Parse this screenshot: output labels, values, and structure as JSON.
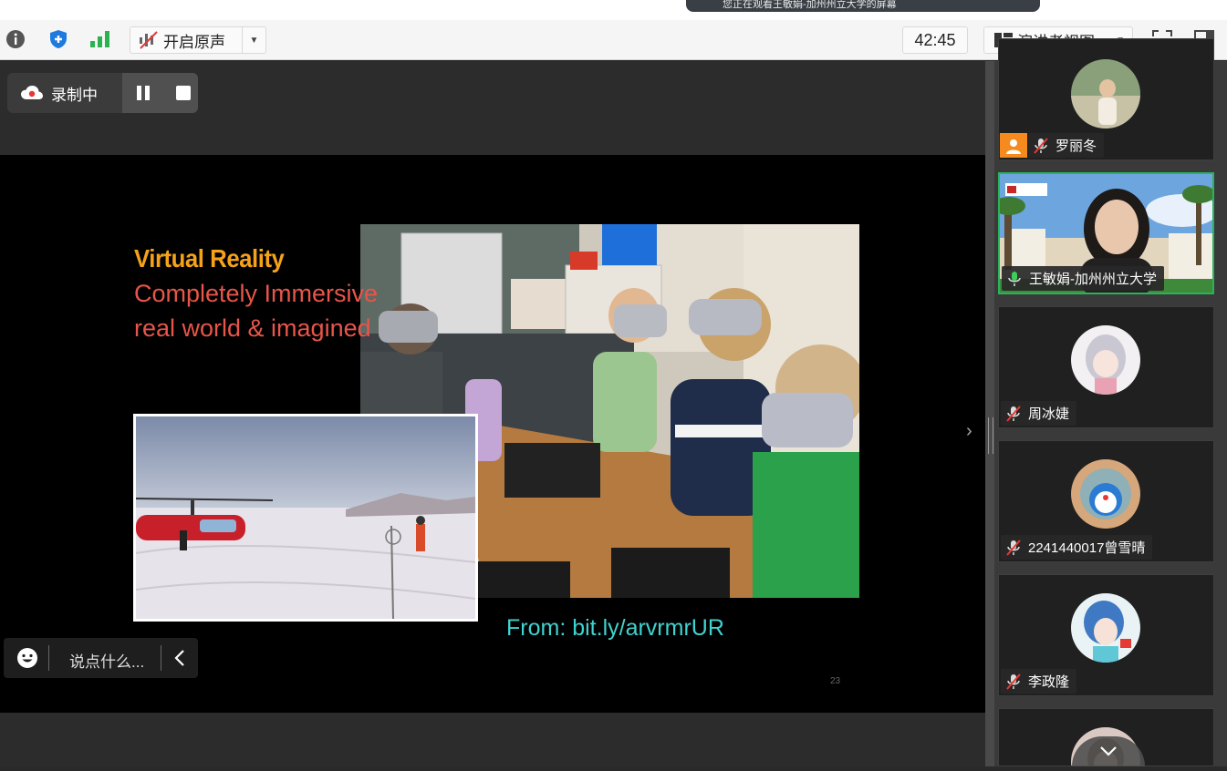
{
  "banner": {
    "text": "您正在观看王敏娟-加州州立大学的屏幕"
  },
  "toolbar": {
    "original_sound_label": "开启原声",
    "timer": "42:45",
    "view_label": "演讲者视图"
  },
  "recording": {
    "label": "录制中"
  },
  "slide": {
    "title": "Virtual Reality",
    "line1": "Completely Immersive",
    "line2": "real world & imagined",
    "source": "From: bit.ly/arvrmrUR",
    "page_number": "23"
  },
  "chat": {
    "placeholder": "说点什么..."
  },
  "participants": [
    {
      "name": "罗丽冬",
      "mic": "muted",
      "host": true
    },
    {
      "name": "王敏娟-加州州立大学",
      "mic": "active",
      "speaking": true
    },
    {
      "name": "周冰婕",
      "mic": "muted"
    },
    {
      "name": "2241440017曾雪晴",
      "mic": "muted"
    },
    {
      "name": "李政隆",
      "mic": "muted"
    }
  ],
  "colors": {
    "accent_green": "#29b35a",
    "title_orange": "#f5a21a",
    "slide_red": "#e8554a",
    "source_cyan": "#3fd3d0",
    "host_orange": "#f58a1f"
  }
}
